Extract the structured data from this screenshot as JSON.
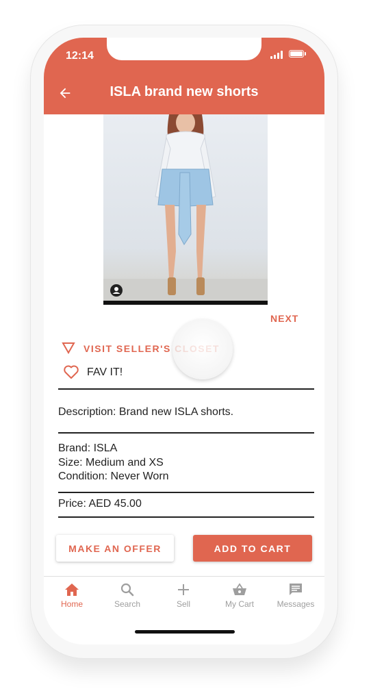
{
  "status_bar": {
    "time": "12:14"
  },
  "header": {
    "title": "ISLA brand new shorts",
    "back_icon": "arrow-left-icon"
  },
  "product": {
    "next_label": "NEXT",
    "visit_closet_label": "VISIT SELLER'S CLOSET",
    "fav_label": "FAV IT!",
    "description": "Description: Brand new ISLA shorts.",
    "brand": "Brand: ISLA",
    "size": "Size: Medium and XS",
    "condition": "Condition: Never Worn",
    "price": "Price: AED 45.00"
  },
  "actions": {
    "offer_label": "MAKE AN OFFER",
    "cart_label": "ADD TO CART"
  },
  "bottom_nav": {
    "items": [
      {
        "label": "Home",
        "icon": "home-icon",
        "active": true
      },
      {
        "label": "Search",
        "icon": "search-icon",
        "active": false
      },
      {
        "label": "Sell",
        "icon": "plus-icon",
        "active": false
      },
      {
        "label": "My Cart",
        "icon": "basket-icon",
        "active": false
      },
      {
        "label": "Messages",
        "icon": "message-icon",
        "active": false
      }
    ]
  },
  "colors": {
    "accent": "#e06650",
    "text": "#222222",
    "nav_inactive": "#9e9e9e"
  }
}
